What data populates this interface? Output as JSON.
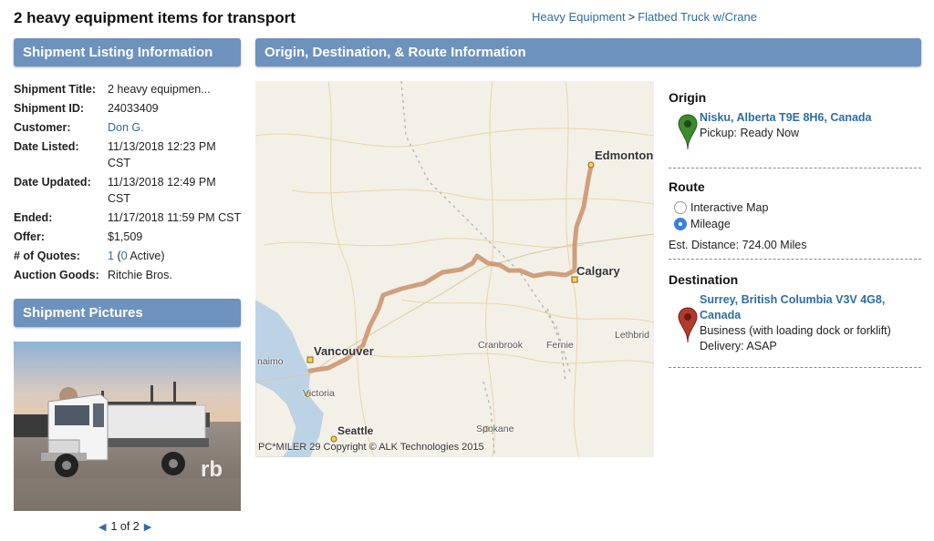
{
  "page": {
    "title": "2 heavy equipment items for transport"
  },
  "breadcrumb": {
    "category": "Heavy Equipment",
    "separator": ">",
    "subcategory": "Flatbed Truck w/Crane"
  },
  "listing": {
    "header": "Shipment Listing Information",
    "rows": [
      {
        "label": "Shipment Title:",
        "value": "2 heavy equipmen..."
      },
      {
        "label": "Shipment ID:",
        "value": "24033409"
      },
      {
        "label": "Customer:",
        "value": "Don G."
      },
      {
        "label": "Date Listed:",
        "value": "11/13/2018 12:23 PM CST"
      },
      {
        "label": "Date Updated:",
        "value": "11/13/2018 12:49 PM CST"
      },
      {
        "label": "Ended:",
        "value": "11/17/2018 11:59 PM CST"
      },
      {
        "label": "Offer:",
        "value": "$1,509"
      },
      {
        "label": "# of Quotes:",
        "quotes_total": "1",
        "quotes_open": "(",
        "quotes_active": "0",
        "quotes_close": " Active)"
      },
      {
        "label": "Auction Goods:",
        "value": "Ritchie Bros."
      }
    ]
  },
  "pictures": {
    "header": "Shipment Pictures",
    "watermark": "rb",
    "pager": "1 of 2"
  },
  "route_section": {
    "header": "Origin, Destination, & Route Information"
  },
  "map": {
    "cities": [
      "Edmonton",
      "Calgary",
      "Vancouver",
      "Victoria",
      "Seattle",
      "Spokane",
      "Cranbrook",
      "Fernie",
      "Lethbrid",
      "naimo"
    ],
    "copyright": "PC*MILER 29 Copyright © ALK Technologies 2015",
    "colors": {
      "route": "#c9906a",
      "land": "#f3f0e8",
      "water": "#bcd3e6"
    }
  },
  "origin": {
    "heading": "Origin",
    "address": "Nisku, Alberta T9E 8H6, Canada",
    "status": "Pickup: Ready Now",
    "pin_color": "#3d8b2e"
  },
  "route": {
    "heading": "Route",
    "options": [
      {
        "label": "Interactive Map",
        "checked": false
      },
      {
        "label": "Mileage",
        "checked": true
      }
    ],
    "distance": "Est. Distance: 724.00 Miles"
  },
  "destination": {
    "heading": "Destination",
    "address": "Surrey, British Columbia V3V 4G8, Canada",
    "type": "Business (with loading dock or forklift)",
    "delivery": "Delivery: ASAP",
    "pin_color": "#b03a2e"
  }
}
